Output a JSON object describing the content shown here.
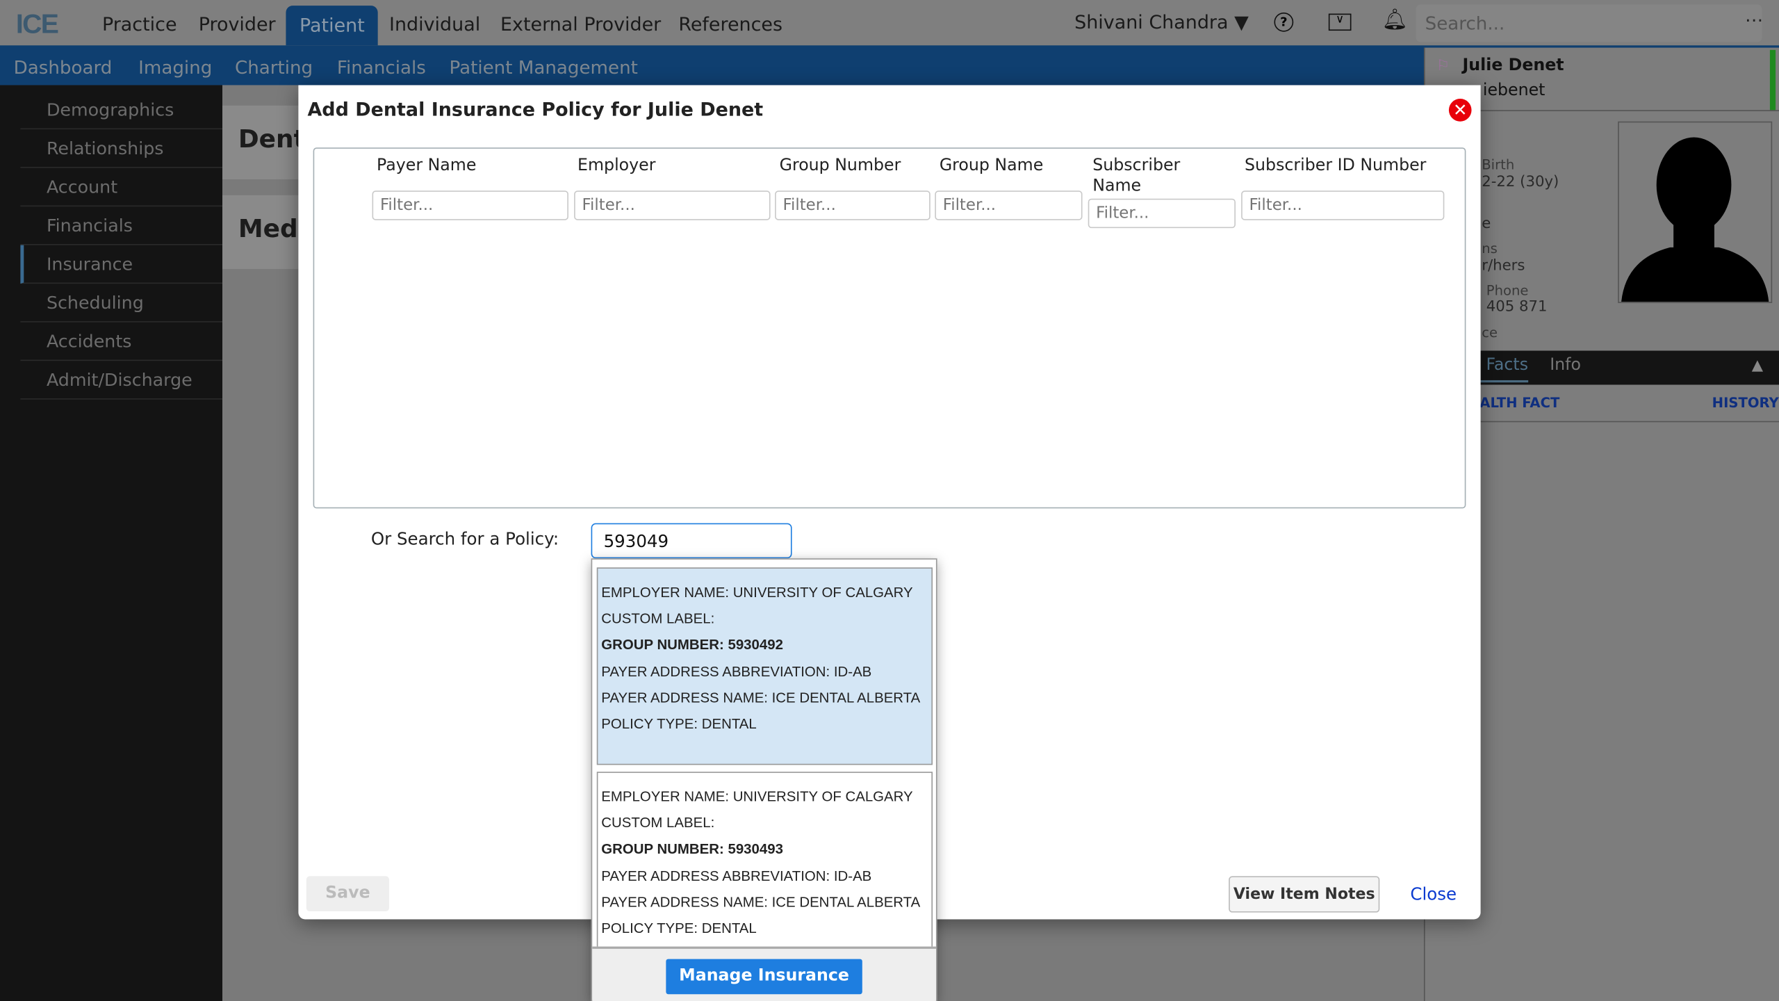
{
  "topnav": {
    "logo": "ICE",
    "items": [
      "Practice",
      "Provider",
      "Patient",
      "Individual",
      "External Provider",
      "References"
    ],
    "active": "Patient",
    "user": "Shivani Chandra",
    "search_placeholder": "Search..."
  },
  "subnav": {
    "items": [
      "Dashboard",
      "Imaging",
      "Charting",
      "Financials",
      "Patient Management"
    ]
  },
  "sidebar": {
    "items": [
      "Demographics",
      "Relationships",
      "Account",
      "Financials",
      "Insurance",
      "Scheduling",
      "Accidents",
      "Admit/Discharge"
    ],
    "active": "Insurance"
  },
  "main": {
    "card1": "Dent",
    "card2": "Medi"
  },
  "patient_panel": {
    "name": "Julie Denet",
    "alias": "iebenet",
    "birth_label": "Birth",
    "birth_value": "2-22 (30y)",
    "frag_e": "e",
    "pronouns_label": "ns",
    "pronouns_value": "r/hers",
    "phone_label": "Phone",
    "phone_value": "405 871",
    "frag_ce": "ce",
    "tabs": [
      "n Facts",
      "Info"
    ],
    "health_fact": "EALTH FACT",
    "history": "HISTORY",
    "status_color": "#1f8a1f"
  },
  "modal": {
    "title": "Add Dental Insurance Policy for Julie Denet",
    "columns": [
      "Payer Name",
      "Employer",
      "Group Number",
      "Group Name",
      "Subscriber Name",
      "Subscriber ID Number"
    ],
    "filter_placeholder": "Filter...",
    "search_label": "Or Search for a Policy:",
    "search_value": "593049",
    "results": [
      {
        "lines": [
          "EMPLOYER NAME: UNIVERSITY OF CALGARY",
          "CUSTOM LABEL:",
          "GROUP NUMBER: 5930492",
          "PAYER ADDRESS ABBREVIATION: ID-AB",
          "PAYER ADDRESS NAME: ICE DENTAL ALBERTA",
          "POLICY TYPE: DENTAL"
        ],
        "highlighted": true
      },
      {
        "lines": [
          "EMPLOYER NAME: UNIVERSITY OF CALGARY",
          "CUSTOM LABEL:",
          "GROUP NUMBER: 5930493",
          "PAYER ADDRESS ABBREVIATION: ID-AB",
          "PAYER ADDRESS NAME: ICE DENTAL ALBERTA",
          "POLICY TYPE: DENTAL"
        ],
        "highlighted": false
      }
    ],
    "manage_label": "Manage Insurance",
    "save_label": "Save",
    "notes_label": "View Item Notes",
    "close_label": "Close",
    "accent": "#1e7ee0"
  }
}
